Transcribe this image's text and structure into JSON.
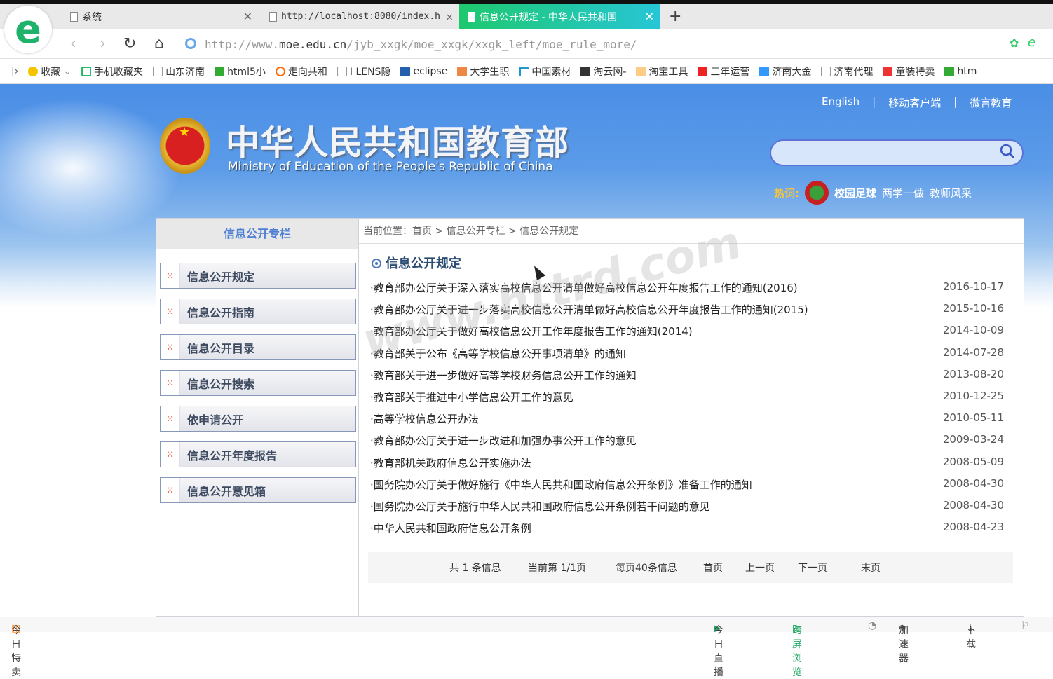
{
  "browser": {
    "tabs": [
      {
        "label": "系统",
        "active": false
      },
      {
        "label": "http://localhost:8080/index.h",
        "active": false
      },
      {
        "label": "信息公开规定 - 中华人民共和国",
        "active": true
      }
    ],
    "new_tab": "+",
    "url_prefix": "http://www.",
    "url_host": "moe.edu.cn",
    "url_path": "/jyb_xxgk/moe_xxgk/xxgk_left/moe_rule_more/",
    "bookmarks": [
      "收藏",
      "手机收藏夹",
      "山东济南",
      "html5小",
      "走向共和",
      "I LENS隐",
      "eclipse",
      "大学生职",
      "中国素材",
      "淘云网-",
      "淘宝工具",
      "三年运营",
      "济南大金",
      "济南代理",
      "童装特卖",
      "htm"
    ],
    "status_left": "今日特卖",
    "status_right": [
      "今日直播",
      "跨屏浏览",
      "加速器",
      "下载"
    ]
  },
  "header": {
    "title": "中华人民共和国教育部",
    "subtitle": "Ministry of Education of the People's Republic of China",
    "links": [
      "English",
      "|",
      "移动客户端",
      "|",
      "微言教育"
    ],
    "search_placeholder": "",
    "hot_label": "热词:",
    "hot_words": [
      "校园足球",
      "两学一做",
      "教师风采"
    ]
  },
  "sidebar": {
    "title": "信息公开专栏",
    "items": [
      "信息公开规定",
      "信息公开指南",
      "信息公开目录",
      "信息公开搜索",
      "依申请公开",
      "信息公开年度报告",
      "信息公开意见箱"
    ]
  },
  "main": {
    "breadcrumb": "当前位置：首页 > 信息公开专栏 > 信息公开规定",
    "title": "信息公开规定",
    "rows": [
      {
        "title": "·教育部办公厅关于深入落实高校信息公开清单做好高校信息公开年度报告工作的通知(2016)",
        "date": "2016-10-17"
      },
      {
        "title": "·教育部办公厅关于进一步落实高校信息公开清单做好高校信息公开年度报告工作的通知(2015)",
        "date": "2015-10-16"
      },
      {
        "title": "·教育部办公厅关于做好高校信息公开工作年度报告工作的通知(2014)",
        "date": "2014-10-09"
      },
      {
        "title": "·教育部关于公布《高等学校信息公开事项清单》的通知",
        "date": "2014-07-28"
      },
      {
        "title": "·教育部关于进一步做好高等学校财务信息公开工作的通知",
        "date": "2013-08-20"
      },
      {
        "title": "·教育部关于推进中小学信息公开工作的意见",
        "date": "2010-12-25"
      },
      {
        "title": "·高等学校信息公开办法",
        "date": "2010-05-11"
      },
      {
        "title": "·教育部办公厅关于进一步改进和加强办事公开工作的意见",
        "date": "2009-03-24"
      },
      {
        "title": "·教育部机关政府信息公开实施办法",
        "date": "2008-05-09"
      },
      {
        "title": "·国务院办公厅关于做好施行《中华人民共和国政府信息公开条例》准备工作的通知",
        "date": "2008-04-30"
      },
      {
        "title": "·国务院办公厅关于施行中华人民共和国政府信息公开条例若干问题的意见",
        "date": "2008-04-30"
      },
      {
        "title": "·中华人民共和国政府信息公开条例",
        "date": "2008-04-23"
      }
    ],
    "pager": {
      "total": "共 1 条信息",
      "current": "当前第 1/1页",
      "per_page": "每页40条信息",
      "first": "首页",
      "prev": "上一页",
      "next": "下一页",
      "last": "末页"
    }
  },
  "watermark": "www.httrd.com"
}
